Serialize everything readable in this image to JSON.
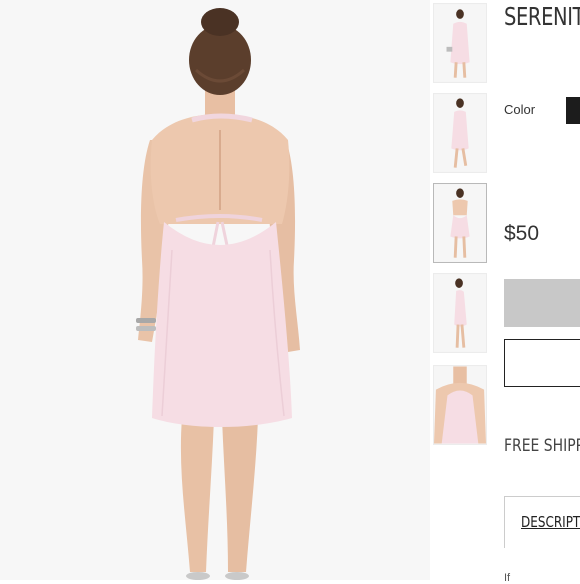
{
  "product": {
    "title": "SERENIT",
    "color_label": "Color",
    "color_swatch": "#1c1c1c",
    "price": "$50",
    "add_to_bag_label": "",
    "wishlist_label": "",
    "shipping_text": "FREE SHIPP",
    "tabs": [
      {
        "label": "DESCRIPTI"
      }
    ],
    "description_snippet": "If"
  },
  "gallery": {
    "selected_index": 2,
    "thumbnails": [
      {
        "view": "front"
      },
      {
        "view": "front-walk"
      },
      {
        "view": "back"
      },
      {
        "view": "side"
      },
      {
        "view": "neckline-detail"
      }
    ],
    "dress_color": "#f6dde4",
    "skin_color": "#eac4a8"
  }
}
